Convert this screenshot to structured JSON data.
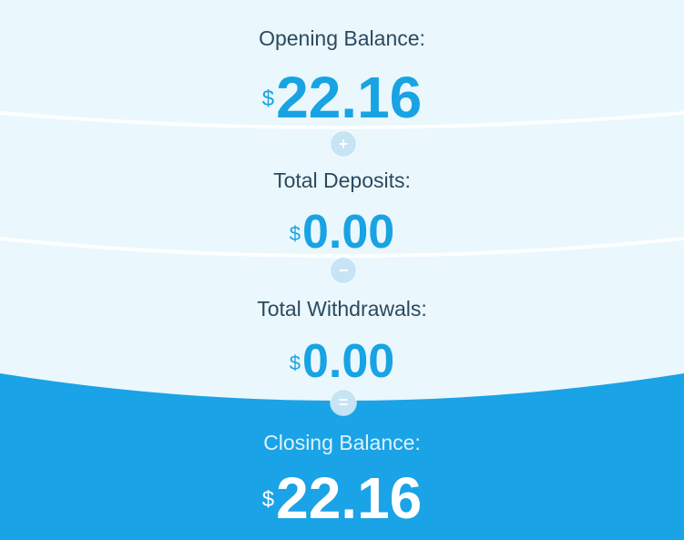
{
  "summary": {
    "opening": {
      "label": "Opening Balance:",
      "currency": "$",
      "value": "22.16"
    },
    "deposits": {
      "label": "Total Deposits:",
      "currency": "$",
      "value": "0.00"
    },
    "withdrawals": {
      "label": "Total Withdrawals:",
      "currency": "$",
      "value": "0.00"
    },
    "closing": {
      "label": "Closing Balance:",
      "currency": "$",
      "value": "22.16"
    },
    "operators": {
      "plus": "+",
      "minus": "−",
      "equals": "="
    }
  },
  "colors": {
    "panel_bg": "#eaf7fd",
    "band_bg": "#1aa3e6",
    "label_text": "#2c4a5e",
    "amount_text": "#18a3e3",
    "operator_circle": "#c6e4f4"
  }
}
